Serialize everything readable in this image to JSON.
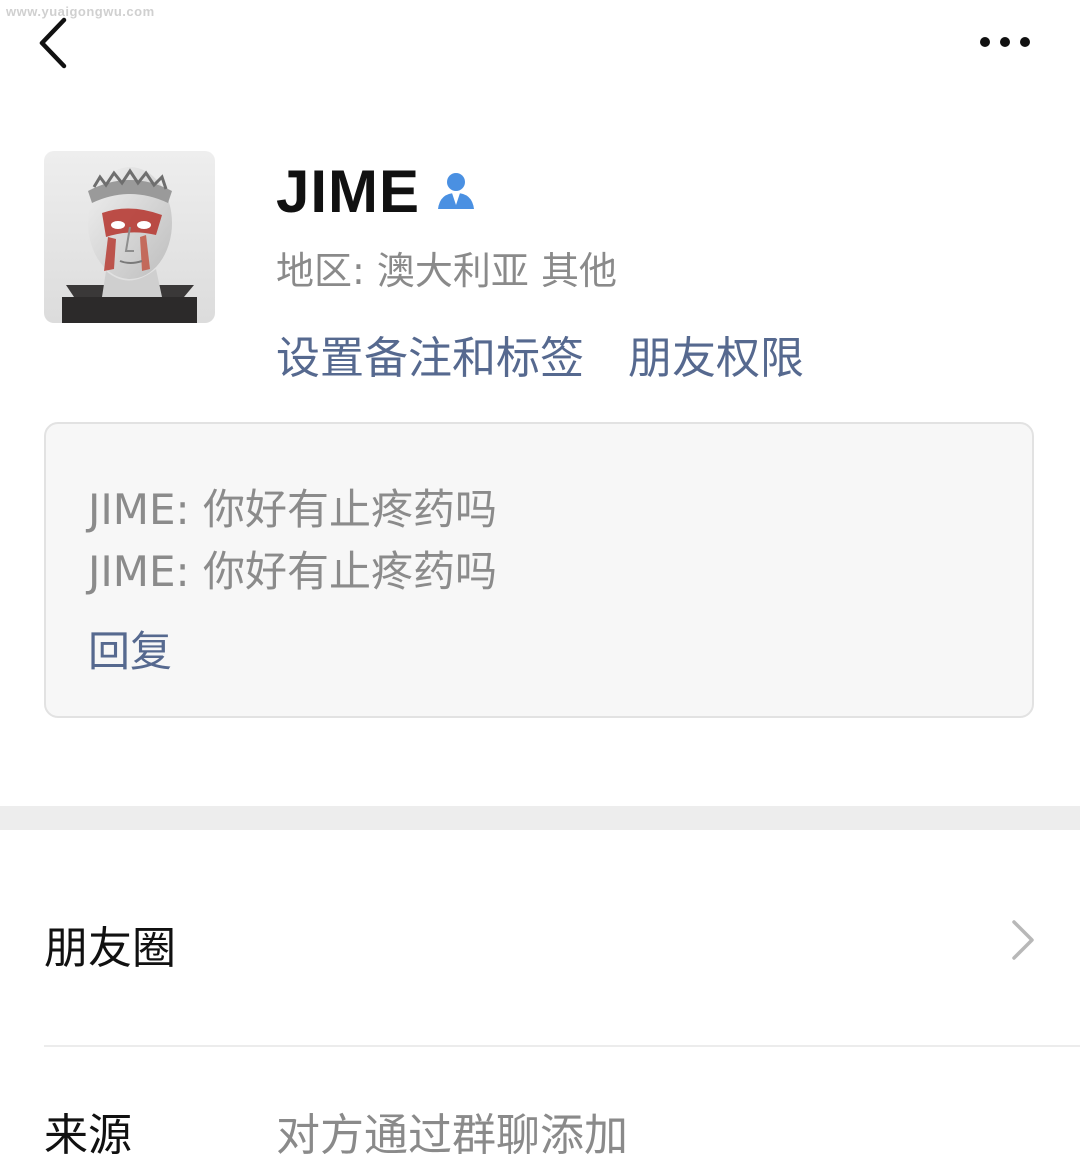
{
  "watermark": "www.yuaigongwu.com",
  "top_bar": {
    "back_icon": "chevron-left-icon",
    "more_icon": "ellipsis-icon"
  },
  "profile": {
    "avatar": "avatar-image",
    "name": "JIME",
    "verify_icon": "person-icon",
    "region_label": "地区: ",
    "region_value": "澳大利亚  其他",
    "set_remark_label": "设置备注和标签",
    "permissions_label": "朋友权限"
  },
  "greeting": {
    "messages": [
      "JIME: 你好有止疼药吗",
      "JIME: 你好有止疼药吗"
    ],
    "reply_label": "回复"
  },
  "rows": {
    "moments_label": "朋友圈",
    "chevron_icon": "chevron-right-icon",
    "source_label": "来源",
    "source_value": "对方通过群聊添加"
  },
  "colors": {
    "link": "#56698f",
    "muted_text": "#8a8a8a",
    "verify_blue": "#4a90e2",
    "section_gap": "#ededed"
  }
}
